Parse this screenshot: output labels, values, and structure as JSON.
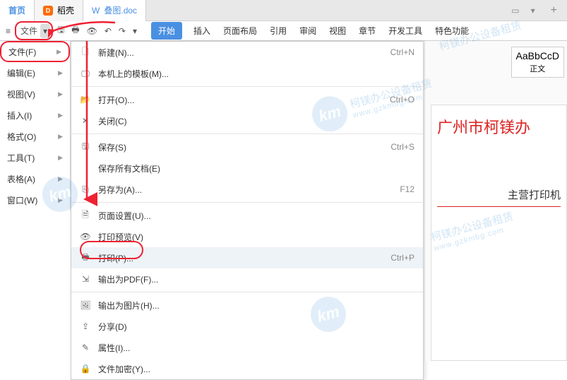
{
  "tabs": {
    "home": "首页",
    "doke": "稻壳",
    "doc": "叠图.doc",
    "plus": "+"
  },
  "toolbar": {
    "file_label": "文件",
    "ribbon": [
      "开始",
      "插入",
      "页面布局",
      "引用",
      "审阅",
      "视图",
      "章节",
      "开发工具",
      "特色功能"
    ]
  },
  "side": {
    "items": [
      "文件(F)",
      "编辑(E)",
      "视图(V)",
      "插入(I)",
      "格式(O)",
      "工具(T)",
      "表格(A)",
      "窗口(W)"
    ]
  },
  "menu": {
    "new": "新建(N)...",
    "local_tpl": "本机上的模板(M)...",
    "open": "打开(O)...",
    "close": "关闭(C)",
    "save": "保存(S)",
    "save_all": "保存所有文档(E)",
    "save_as": "另存为(A)...",
    "page_setup": "页面设置(U)...",
    "print_preview": "打印预览(V)",
    "print": "打印(P)...",
    "export_pdf": "输出为PDF(F)...",
    "export_img": "输出为图片(H)...",
    "share": "分享(D)",
    "properties": "属性(I)...",
    "encrypt": "文件加密(Y)...",
    "sc_new": "Ctrl+N",
    "sc_open": "Ctrl+O",
    "sc_save": "Ctrl+S",
    "sc_saveas": "F12",
    "sc_print": "Ctrl+P"
  },
  "doc": {
    "style_sample": "AaBbCcD",
    "style_name": "正文",
    "title": "广州市柯镁办",
    "subtitle": "主营打印机"
  },
  "wm": {
    "logo": "km",
    "text": "柯镁办公设备租赁",
    "url": "www.gzkmbg.com"
  }
}
